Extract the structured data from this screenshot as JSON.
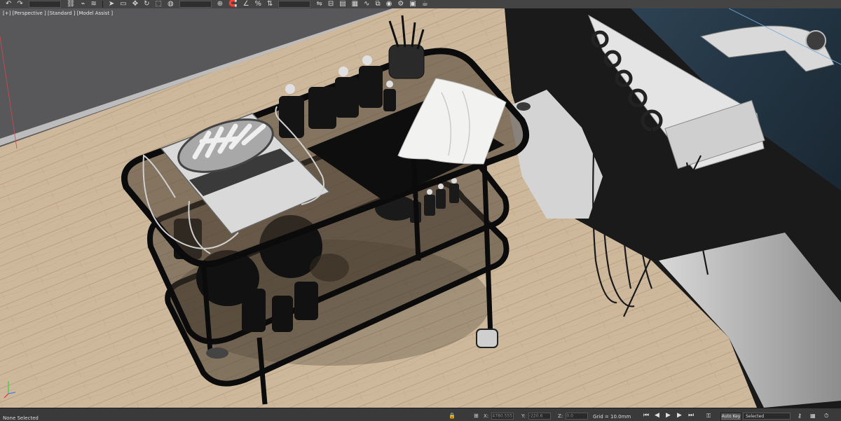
{
  "viewport": {
    "label": "[+] [Perspective ] [Standard ] [Model Assist ]"
  },
  "statusbar": {
    "selection_text": "None Selected",
    "x_label": "X:",
    "x_value": "4780.555",
    "y_label": "Y:",
    "y_value": "-220.6",
    "z_label": "Z:",
    "z_value": "0.0",
    "grid_text": "Grid = 10.0mm",
    "autokey_label": "Auto Key",
    "selected_label": "Selected"
  },
  "icons": {
    "undo": "undo-icon",
    "redo": "redo-icon",
    "link": "link-icon",
    "select": "select-arrow-icon",
    "move": "move-icon",
    "rotate": "rotate-icon",
    "scale": "scale-icon",
    "snap": "snap-icon",
    "percent": "percent-snap-icon",
    "play": "play-icon",
    "key": "key-icon",
    "lock": "lock-icon"
  },
  "colors": {
    "floor": "#cbb69a",
    "wall": "#5a5a58",
    "cart_frame": "#0b0b0b",
    "glass": "#6b5a47",
    "chair": "#1f2f3c",
    "towel": "#f2f2f0",
    "ultrasonic_unit": "#dcdcdc"
  }
}
